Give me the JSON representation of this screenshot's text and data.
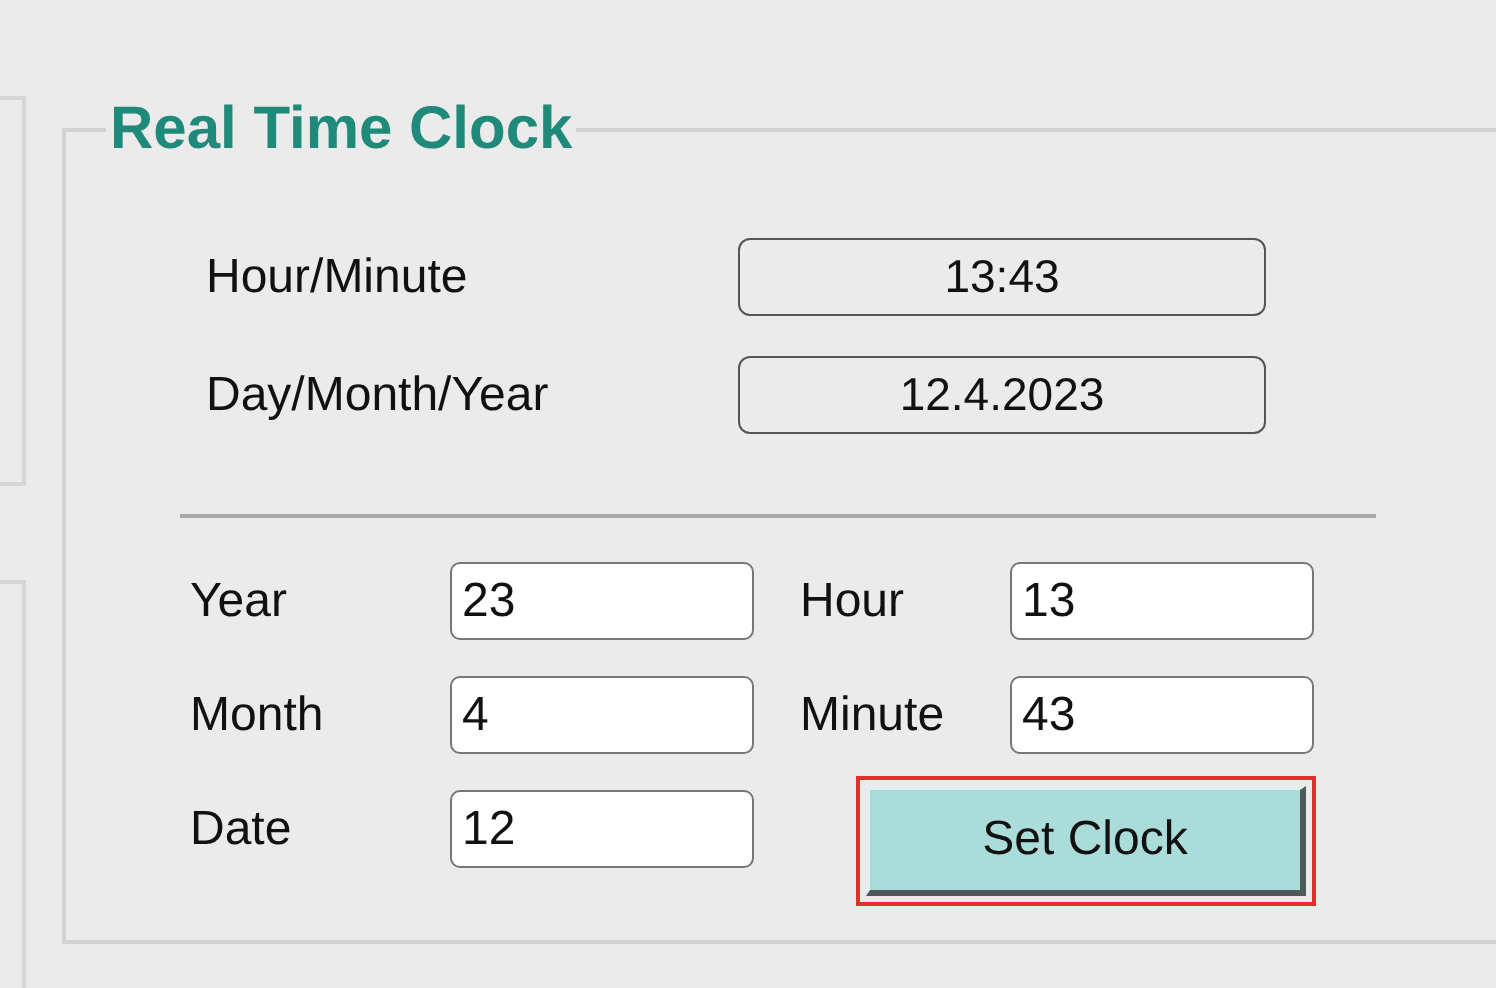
{
  "group": {
    "title": "Real Time Clock"
  },
  "readouts": [
    {
      "label": "Hour/Minute",
      "value": "13:43"
    },
    {
      "label": "Day/Month/Year",
      "value": "12.4.2023"
    }
  ],
  "fields": [
    {
      "label": "Year",
      "value": "23"
    },
    {
      "label": "Hour",
      "value": "13"
    },
    {
      "label": "Month",
      "value": "4"
    },
    {
      "label": "Minute",
      "value": "43"
    },
    {
      "label": "Date",
      "value": "12"
    }
  ],
  "button": {
    "label": "Set Clock",
    "highlighted": true
  }
}
